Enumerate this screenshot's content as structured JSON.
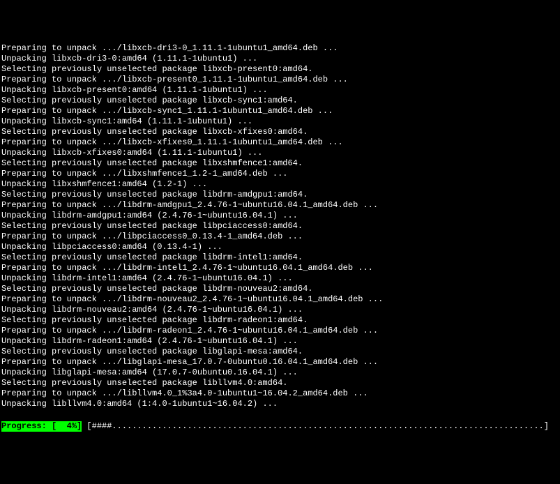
{
  "terminal": {
    "lines": [
      "Preparing to unpack .../libxcb-dri3-0_1.11.1-1ubuntu1_amd64.deb ...",
      "Unpacking libxcb-dri3-0:amd64 (1.11.1-1ubuntu1) ...",
      "Selecting previously unselected package libxcb-present0:amd64.",
      "Preparing to unpack .../libxcb-present0_1.11.1-1ubuntu1_amd64.deb ...",
      "Unpacking libxcb-present0:amd64 (1.11.1-1ubuntu1) ...",
      "Selecting previously unselected package libxcb-sync1:amd64.",
      "Preparing to unpack .../libxcb-sync1_1.11.1-1ubuntu1_amd64.deb ...",
      "Unpacking libxcb-sync1:amd64 (1.11.1-1ubuntu1) ...",
      "Selecting previously unselected package libxcb-xfixes0:amd64.",
      "Preparing to unpack .../libxcb-xfixes0_1.11.1-1ubuntu1_amd64.deb ...",
      "Unpacking libxcb-xfixes0:amd64 (1.11.1-1ubuntu1) ...",
      "Selecting previously unselected package libxshmfence1:amd64.",
      "Preparing to unpack .../libxshmfence1_1.2-1_amd64.deb ...",
      "Unpacking libxshmfence1:amd64 (1.2-1) ...",
      "Selecting previously unselected package libdrm-amdgpu1:amd64.",
      "Preparing to unpack .../libdrm-amdgpu1_2.4.76-1~ubuntu16.04.1_amd64.deb ...",
      "Unpacking libdrm-amdgpu1:amd64 (2.4.76-1~ubuntu16.04.1) ...",
      "Selecting previously unselected package libpciaccess0:amd64.",
      "Preparing to unpack .../libpciaccess0_0.13.4-1_amd64.deb ...",
      "Unpacking libpciaccess0:amd64 (0.13.4-1) ...",
      "Selecting previously unselected package libdrm-intel1:amd64.",
      "Preparing to unpack .../libdrm-intel1_2.4.76-1~ubuntu16.04.1_amd64.deb ...",
      "Unpacking libdrm-intel1:amd64 (2.4.76-1~ubuntu16.04.1) ...",
      "Selecting previously unselected package libdrm-nouveau2:amd64.",
      "Preparing to unpack .../libdrm-nouveau2_2.4.76-1~ubuntu16.04.1_amd64.deb ...",
      "Unpacking libdrm-nouveau2:amd64 (2.4.76-1~ubuntu16.04.1) ...",
      "Selecting previously unselected package libdrm-radeon1:amd64.",
      "Preparing to unpack .../libdrm-radeon1_2.4.76-1~ubuntu16.04.1_amd64.deb ...",
      "Unpacking libdrm-radeon1:amd64 (2.4.76-1~ubuntu16.04.1) ...",
      "Selecting previously unselected package libglapi-mesa:amd64.",
      "Preparing to unpack .../libglapi-mesa_17.0.7-0ubuntu0.16.04.1_amd64.deb ...",
      "Unpacking libglapi-mesa:amd64 (17.0.7-0ubuntu0.16.04.1) ...",
      "Selecting previously unselected package libllvm4.0:amd64.",
      "Preparing to unpack .../libllvm4.0_1%3a4.0-1ubuntu1~16.04.2_amd64.deb ...",
      "Unpacking libllvm4.0:amd64 (1:4.0-1ubuntu1~16.04.2) ..."
    ],
    "progress": {
      "label": "Progress: [  4%]",
      "bar": " [####......................................................................................] "
    }
  }
}
